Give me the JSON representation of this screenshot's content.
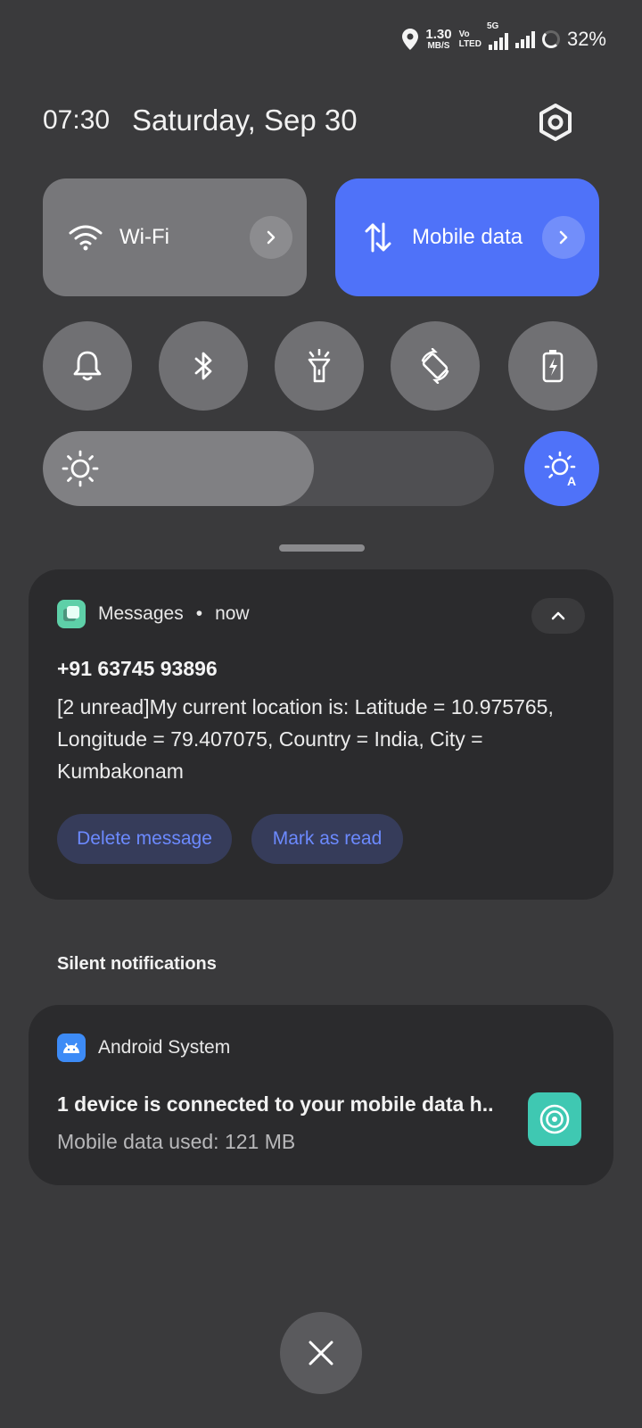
{
  "status_bar": {
    "speed_value": "1.30",
    "speed_unit": "MB/S",
    "volte_top": "Vo",
    "volte_bottom": "LTED",
    "network": "5G",
    "battery": "32%"
  },
  "header": {
    "time": "07:30",
    "date": "Saturday, Sep 30"
  },
  "tiles": {
    "wifi_label": "Wi-Fi",
    "mobile_data_label": "Mobile data"
  },
  "brightness": {
    "level": 0.6
  },
  "colors": {
    "accent": "#4f72f9",
    "card_bg": "#2b2b2d",
    "hotspot_icon": "#3fc8b2",
    "messages_icon": "#5ed0a8",
    "android_icon": "#3d8bf6"
  },
  "notifications": {
    "messages": {
      "app": "Messages",
      "time": "now",
      "sender": "+91 63745 93896",
      "body": "[2 unread]My current location is: Latitude = 10.975765, Longitude = 79.407075, Country = India, City = Kumbakonam",
      "actions": [
        "Delete message",
        "Mark as read"
      ]
    },
    "silent_header": "Silent notifications",
    "system": {
      "app": "Android System",
      "title": "1 device is connected to your mobile data h..",
      "subtitle": "Mobile data used: 121 MB"
    }
  }
}
